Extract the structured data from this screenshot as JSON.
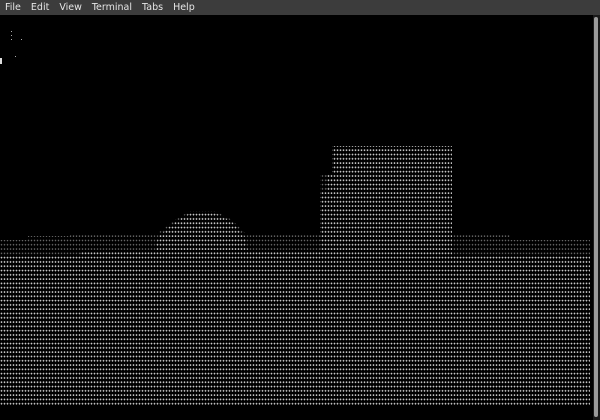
{
  "menubar": {
    "items": [
      "File",
      "Edit",
      "View",
      "Terminal",
      "Tabs",
      "Help"
    ]
  },
  "terminal": {
    "content_description_icon": "ascii-dot-art",
    "foreground": "#c8c8c8",
    "background": "#000000"
  }
}
